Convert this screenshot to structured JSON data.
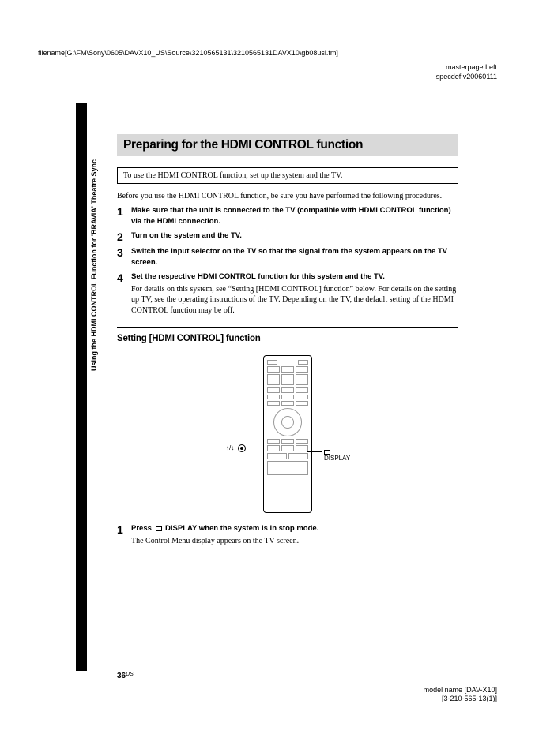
{
  "header": {
    "filename": "filename[G:\\FM\\Sony\\0605\\DAVX10_US\\Source\\3210565131\\3210565131DAVX10\\gb08usi.fm]",
    "masterpage": "masterpage:Left",
    "specdef": "specdef v20060111"
  },
  "sidebar": {
    "label": "Using the HDMI CONTROL Function for 'BRAVIA' Theatre Sync"
  },
  "title": "Preparing for the HDMI CONTROL function",
  "note": "To use the HDMI CONTROL function, set up the system and the TV.",
  "intro": "Before you use the HDMI CONTROL function, be sure you have performed the following procedures.",
  "steps": [
    {
      "num": "1",
      "bold": "Make sure that the unit is connected to the TV (compatible with HDMI CONTROL function) via the HDMI connection."
    },
    {
      "num": "2",
      "bold": "Turn on the system and the TV."
    },
    {
      "num": "3",
      "bold": "Switch the input selector on the TV so that the signal from the system appears on the TV screen."
    },
    {
      "num": "4",
      "bold": "Set the respective HDMI CONTROL function for this system and the TV.",
      "detail": "For details on this system, see “Setting [HDMI CONTROL] function” below. For details on the setting up TV, see the operating instructions of the TV. Depending on the TV, the default setting of the HDMI CONTROL function may be off."
    }
  ],
  "subhead": "Setting [HDMI CONTROL] function",
  "callouts": {
    "left": "↑/↓,",
    "right": "DISPLAY"
  },
  "setting_steps": [
    {
      "num": "1",
      "press_prefix": "Press ",
      "press_bold_after": "DISPLAY when the system is in stop mode.",
      "detail": "The Control Menu display appears on the TV screen."
    }
  ],
  "page": {
    "num": "36",
    "region": "US"
  },
  "footer": {
    "model": "model name [DAV-X10]",
    "doc": "[3-210-565-13(1)]"
  }
}
